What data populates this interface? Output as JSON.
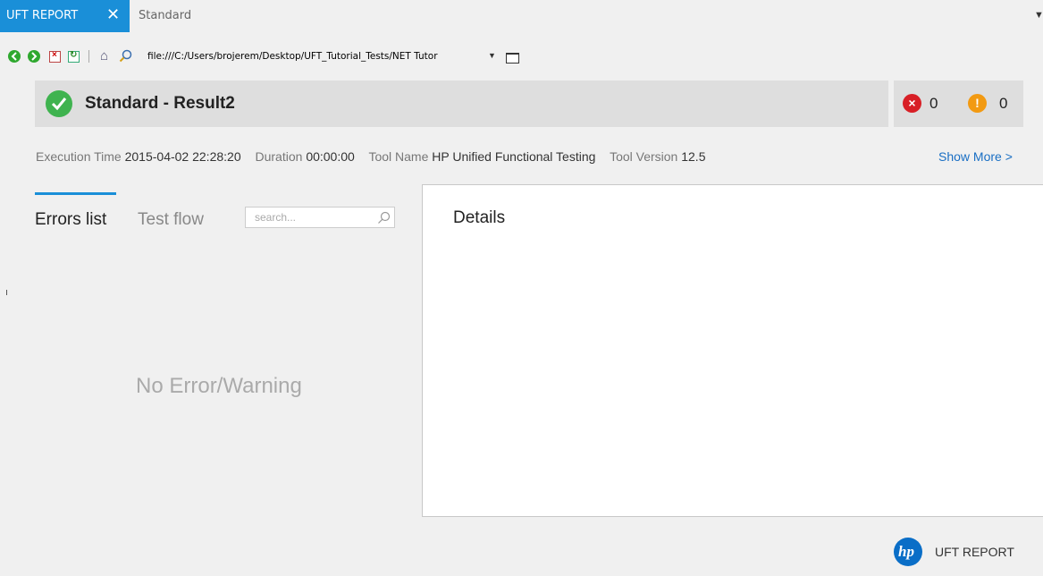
{
  "tabs": {
    "active_label": "UFT REPORT",
    "inactive_label": "Standard"
  },
  "browser": {
    "url": "file:///C:/Users/brojerem/Desktop/UFT_Tutorial_Tests/NET Tutor"
  },
  "header": {
    "title": "Standard - Result2",
    "error_count": "0",
    "warning_count": "0"
  },
  "meta": {
    "execution_time_label": "Execution Time",
    "execution_time_value": "2015-04-02 22:28:20",
    "duration_label": "Duration",
    "duration_value": "00:00:00",
    "tool_name_label": "Tool Name",
    "tool_name_value": "HP Unified Functional Testing",
    "tool_version_label": "Tool Version",
    "tool_version_value": "12.5",
    "show_more": "Show More >"
  },
  "left_panel": {
    "tab_errors": "Errors list",
    "tab_flow": "Test flow",
    "search_placeholder": "search...",
    "empty_message": "No Error/Warning"
  },
  "details": {
    "title": "Details"
  },
  "footer": {
    "logo_text": "hp",
    "label": "UFT REPORT"
  },
  "colors": {
    "accent": "#1a8fd8",
    "success": "#3fb34f",
    "error": "#d81f26",
    "warning": "#f29a12",
    "link": "#1a6fc4"
  },
  "icons": [
    "close-icon",
    "back-icon",
    "forward-icon",
    "stop-icon",
    "refresh-icon",
    "home-icon",
    "search-icon",
    "dropdown-icon",
    "new-tab-icon",
    "check-icon",
    "error-icon",
    "warning-icon",
    "hp-logo-icon",
    "tab-menu-icon"
  ]
}
